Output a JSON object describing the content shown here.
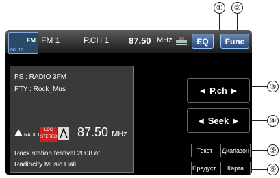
{
  "callouts": [
    "①",
    "②",
    "③",
    "④",
    "⑤",
    "⑥"
  ],
  "topbar": {
    "source_label": "FM",
    "time_label": "00 :15",
    "band": "FM 1",
    "preset": "P.CH 1",
    "frequency": "87.50",
    "frequency_unit": "MHz",
    "eq_label": "EQ",
    "func_label": "Func"
  },
  "info": {
    "ps": "PS   : RADIO 3FM",
    "pty": "PTY : Rock_Mus",
    "radio_logo": "RADIO",
    "loc_label": "LOC",
    "stereo_label": "STEREO",
    "frequency": "87.50",
    "frequency_unit": "MHz",
    "radio_text_1": "Rock station festival 2008 at",
    "radio_text_2": "Radiocity Music Hall"
  },
  "controls": {
    "pch_label": "◄  P.ch  ►",
    "seek_label": "◄  Seek  ►",
    "text_label": "Текст",
    "range_label": "Диапазон",
    "preset_label": "Предуст.",
    "map_label": "Карта"
  },
  "colors": {
    "button_blue": "#2a4a80",
    "loc_red": "#cc2222"
  }
}
